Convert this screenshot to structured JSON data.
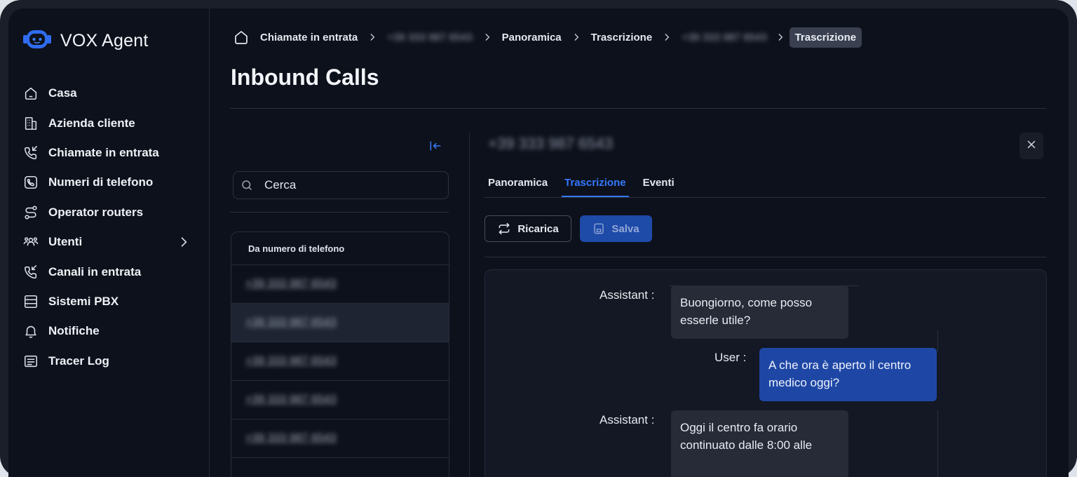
{
  "app": {
    "name": "VOX Agent"
  },
  "sidebar": {
    "items": [
      {
        "label": "Casa",
        "icon": "home-icon"
      },
      {
        "label": "Azienda cliente",
        "icon": "building-icon"
      },
      {
        "label": "Chiamate in entrata",
        "icon": "phone-incoming-icon"
      },
      {
        "label": "Numeri di telefono",
        "icon": "phone-number-icon"
      },
      {
        "label": "Operator routers",
        "icon": "route-icon"
      },
      {
        "label": "Utenti",
        "icon": "users-icon"
      },
      {
        "label": "Canali in entrata",
        "icon": "phone-call-icon"
      },
      {
        "label": "Sistemi PBX",
        "icon": "server-icon"
      },
      {
        "label": "Notifiche",
        "icon": "bell-icon"
      },
      {
        "label": "Tracer Log",
        "icon": "log-icon"
      }
    ]
  },
  "breadcrumb": {
    "items": [
      "Chiamate in entrata",
      "+39 333 987 6543",
      "Panoramica",
      "Trascrizione",
      "+39 333 987 6543",
      "Trascrizione"
    ]
  },
  "page": {
    "title": "Inbound Calls"
  },
  "search": {
    "placeholder": "Cerca"
  },
  "list": {
    "header": "Da numero di telefono",
    "rows": [
      "+39 333 987 6543",
      "+39 333 987 6543",
      "+39 333 987 6543",
      "+39 333 987 6543",
      "+39 333 987 6543"
    ]
  },
  "detail": {
    "phone": "+39 333 987 6543",
    "tabs": [
      "Panoramica",
      "Trascrizione",
      "Eventi"
    ],
    "active_tab": "Trascrizione",
    "reload_label": "Ricarica",
    "save_label": "Salva"
  },
  "transcript": {
    "messages": [
      {
        "speaker": "Assistant :",
        "text": "Buongiorno, come posso esserle utile?"
      },
      {
        "speaker": "User :",
        "text": "A che ora è aperto il centro medico oggi?"
      },
      {
        "speaker": "Assistant :",
        "text": "Oggi il centro fa orario continuato dalle 8:00 alle"
      }
    ]
  },
  "colors": {
    "accent": "#3478ff",
    "background": "#0d111b",
    "user_bubble": "#1e47a5"
  }
}
